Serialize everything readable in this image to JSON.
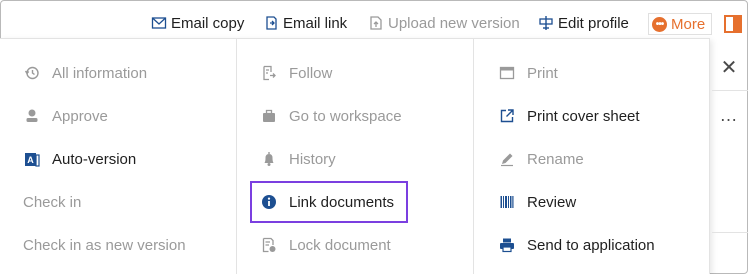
{
  "toolbar": {
    "email_copy": "Email copy",
    "email_link": "Email link",
    "upload_new_version": "Upload new version",
    "edit_profile": "Edit profile",
    "more": "More"
  },
  "menu": {
    "col1": [
      {
        "label": "All information",
        "icon": "history-clock-icon",
        "disabled": true
      },
      {
        "label": "Approve",
        "icon": "person-icon",
        "disabled": true
      },
      {
        "label": "Auto-version",
        "icon": "auto-version-icon",
        "disabled": false
      },
      {
        "label": "Check in",
        "icon": "",
        "disabled": true
      },
      {
        "label": "Check in as new version",
        "icon": "",
        "disabled": true
      }
    ],
    "col2": [
      {
        "label": "Follow",
        "icon": "follow-icon",
        "disabled": true
      },
      {
        "label": "Go to workspace",
        "icon": "briefcase-icon",
        "disabled": true
      },
      {
        "label": "History",
        "icon": "bell-icon",
        "disabled": true
      },
      {
        "label": "Link documents",
        "icon": "info-icon",
        "disabled": false
      },
      {
        "label": "Lock document",
        "icon": "lock-document-icon",
        "disabled": true
      }
    ],
    "col3": [
      {
        "label": "Print",
        "icon": "print-window-icon",
        "disabled": true
      },
      {
        "label": "Print cover sheet",
        "icon": "external-link-icon",
        "disabled": false
      },
      {
        "label": "Rename",
        "icon": "pencil-icon",
        "disabled": true
      },
      {
        "label": "Review",
        "icon": "barcode-icon",
        "disabled": false
      },
      {
        "label": "Send to application",
        "icon": "printer-icon",
        "disabled": false
      }
    ]
  },
  "colors": {
    "accent_orange": "#e6702e",
    "highlight_purple": "#7b3fe0",
    "icon_blue": "#1d4f91",
    "disabled_gray": "#9a9a9a"
  }
}
